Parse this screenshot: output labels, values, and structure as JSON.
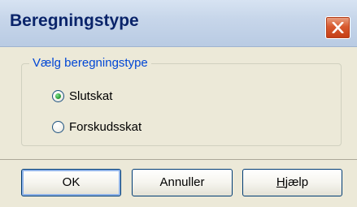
{
  "window": {
    "title": "Beregningstype"
  },
  "group": {
    "legend": "Vælg beregningstype",
    "options": [
      {
        "label": "Slutskat",
        "selected": true
      },
      {
        "label": "Forskudsskat",
        "selected": false
      }
    ]
  },
  "buttons": {
    "ok": "OK",
    "cancel": "Annuller",
    "help": "Hjælp"
  },
  "colors": {
    "title_text": "#0a246a",
    "close_button": "#d85a2f",
    "legend_text": "#0046d5",
    "dialog_background": "#ece9d8"
  },
  "icons": {
    "close": "close-x-icon"
  }
}
